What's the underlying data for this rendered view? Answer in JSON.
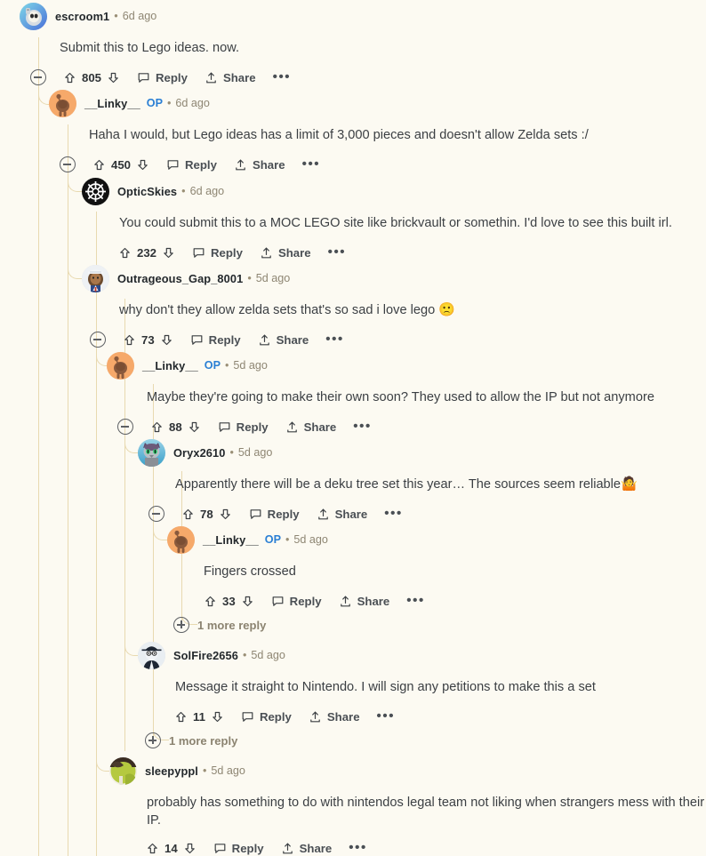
{
  "theme": {
    "background": "#fcfaf2",
    "thread_line": "#e8d9b0",
    "text": "#3b3f43",
    "meta_text": "#8e8673",
    "op_badge": "#2a7fd4"
  },
  "labels": {
    "reply": "Reply",
    "share": "Share",
    "more_actions": "•••",
    "op": "OP",
    "separator": "•"
  },
  "comments": [
    {
      "id": "c1",
      "author": "escroom1",
      "is_op": false,
      "timestamp": "6d ago",
      "body": "Submit this to Lego ideas. now.",
      "votes": "805",
      "collapsible": true,
      "avatar": "astronaut-snoo-avatar"
    },
    {
      "id": "c2",
      "author": "__Linky__",
      "is_op": true,
      "timestamp": "6d ago",
      "body": "Haha I would, but Lego ideas has a limit of 3,000 pieces and doesn't allow Zelda sets :/",
      "votes": "450",
      "collapsible": true,
      "avatar": "brown-snoo-orange-avatar"
    },
    {
      "id": "c3",
      "author": "OpticSkies",
      "is_op": false,
      "timestamp": "6d ago",
      "body": "You could submit this to a MOC LEGO site like brickvault or somethin. I'd love to see this built irl.",
      "votes": "232",
      "collapsible": false,
      "avatar": "ship-wheel-avatar"
    },
    {
      "id": "c4",
      "author": "Outrageous_Gap_8001",
      "is_op": false,
      "timestamp": "5d ago",
      "body": "why don't they allow zelda sets that's so sad i love lego ",
      "emoji": "🙁",
      "votes": "73",
      "collapsible": true,
      "avatar": "sailor-hat-avatar"
    },
    {
      "id": "c5",
      "author": "__Linky__",
      "is_op": true,
      "timestamp": "5d ago",
      "body": "Maybe they're going to make their own soon? They used to allow the IP but not anymore",
      "votes": "88",
      "collapsible": true,
      "avatar": "brown-snoo-orange-avatar"
    },
    {
      "id": "c6",
      "author": "Oryx2610",
      "is_op": false,
      "timestamp": "5d ago",
      "body": "Apparently there will be a deku tree set this year… The sources seem reliable",
      "emoji": "🤷",
      "votes": "78",
      "collapsible": true,
      "avatar": "green-eyed-cat-avatar"
    },
    {
      "id": "c7",
      "author": "__Linky__",
      "is_op": true,
      "timestamp": "5d ago",
      "body": "Fingers crossed",
      "votes": "33",
      "collapsible": false,
      "avatar": "brown-snoo-orange-avatar"
    },
    {
      "id": "c8",
      "author": "SolFire2656",
      "is_op": false,
      "timestamp": "5d ago",
      "body": "Message it straight to Nintendo. I will sign any petitions to make this a set",
      "votes": "11",
      "collapsible": false,
      "avatar": "black-hat-suit-avatar"
    },
    {
      "id": "c9",
      "author": "sleepyppl",
      "is_op": false,
      "timestamp": "5d ago",
      "body": "probably has something to do with nintendos legal team not liking when strangers mess with their IP.",
      "votes": "14",
      "collapsible": false,
      "avatar": "olive-green-avatar"
    }
  ],
  "more_replies": [
    {
      "id": "m1",
      "label": "1 more reply"
    },
    {
      "id": "m2",
      "label": "1 more reply"
    }
  ]
}
